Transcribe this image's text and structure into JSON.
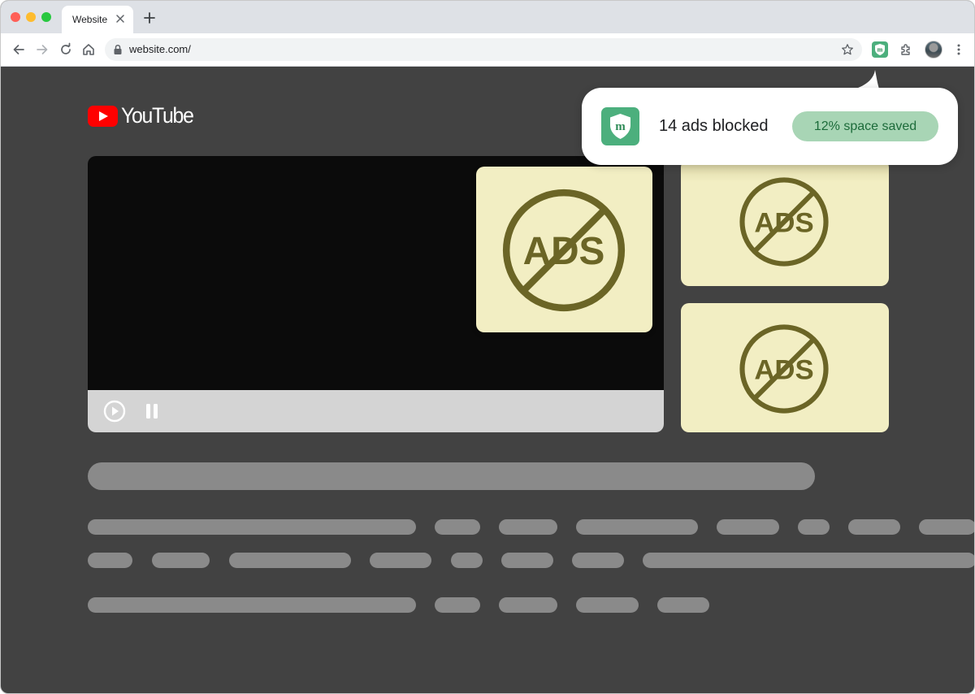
{
  "browser": {
    "tab": {
      "title": "Website"
    },
    "address_bar": {
      "url": "website.com/"
    },
    "extension": {
      "name": "m-extension"
    }
  },
  "page": {
    "logo_text": "YouTube",
    "ad_placeholder_label": "ADS",
    "video_controls": [
      "play",
      "pause"
    ]
  },
  "popup": {
    "blocked_text": "14 ads blocked",
    "saved_badge": "12% space saved"
  },
  "colors": {
    "accent_green": "#4caf7d",
    "badge_bg": "#a8d5b5",
    "badge_text": "#1c6b3a",
    "ad_card_bg": "#f2eec3",
    "ad_icon": "#6b6526",
    "page_bg": "#424242",
    "youtube_red": "#ff0000"
  },
  "icons": {
    "back": "arrow-left-icon",
    "forward": "arrow-right-icon",
    "reload": "reload-icon",
    "home": "home-icon",
    "lock": "lock-icon",
    "bookmark": "star-icon",
    "extensions": "puzzle-icon",
    "menu": "kebab-icon",
    "close_tab": "close-icon",
    "new_tab": "plus-icon"
  }
}
